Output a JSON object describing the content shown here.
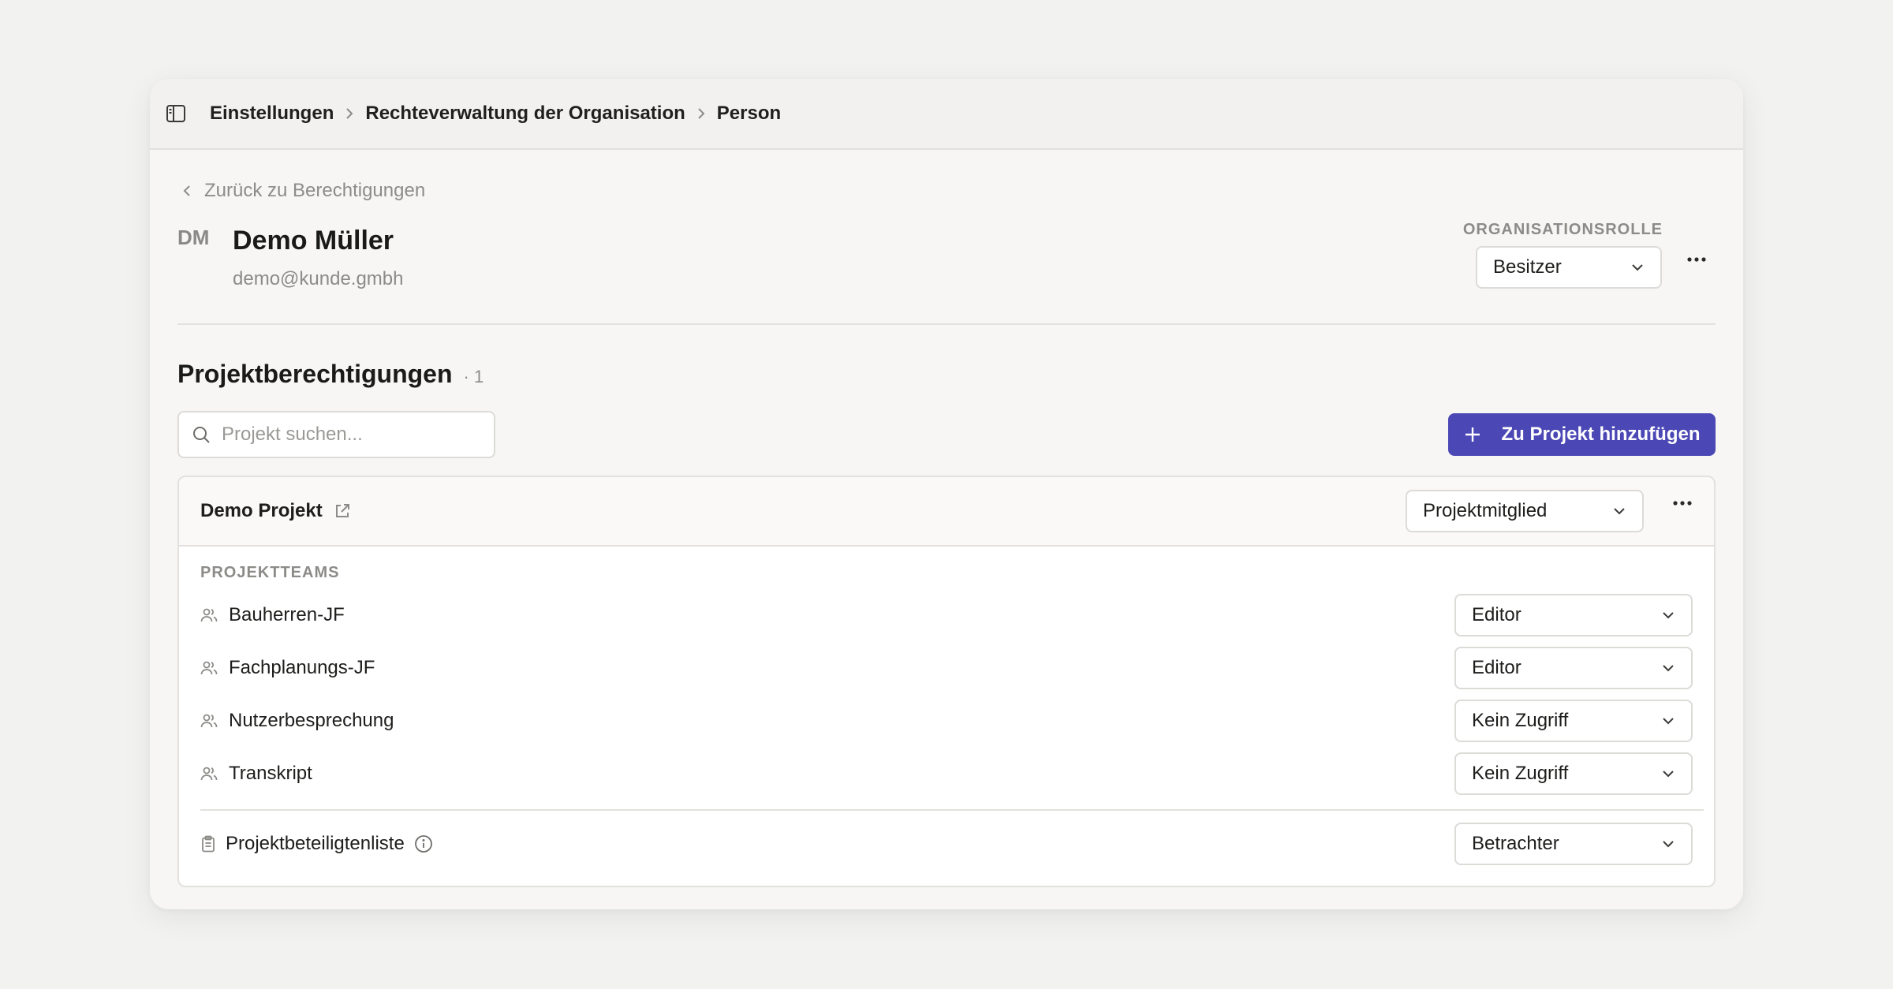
{
  "breadcrumb": {
    "items": [
      "Einstellungen",
      "Rechteverwaltung der Organisation",
      "Person"
    ]
  },
  "back_link": "Zurück zu Berechtigungen",
  "person": {
    "initials": "DM",
    "name": "Demo Müller",
    "email": "demo@kunde.gmbh"
  },
  "org_role": {
    "label": "ORGANISATIONSROLLE",
    "value": "Besitzer"
  },
  "permissions": {
    "title": "Projektberechtigungen",
    "count": "· 1",
    "search_placeholder": "Projekt suchen...",
    "add_button": "Zu Projekt hinzufügen"
  },
  "project": {
    "name": "Demo Projekt",
    "role": "Projektmitglied",
    "teams_label": "PROJEKTTEAMS",
    "teams": [
      {
        "name": "Bauherren-JF",
        "role": "Editor"
      },
      {
        "name": "Fachplanungs-JF",
        "role": "Editor"
      },
      {
        "name": "Nutzerbesprechung",
        "role": "Kein Zugriff"
      },
      {
        "name": "Transkript",
        "role": "Kein Zugriff"
      }
    ],
    "participants": {
      "name": "Projektbeteiligtenliste",
      "role": "Betrachter"
    }
  },
  "colors": {
    "accent": "#4b47b5",
    "background": "#f2f2f1"
  }
}
